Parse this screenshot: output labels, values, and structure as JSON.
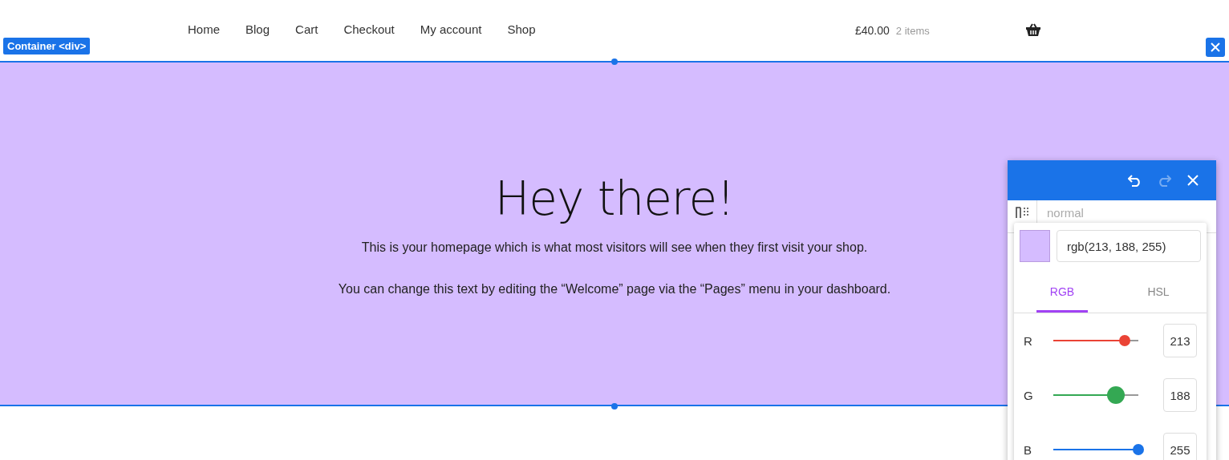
{
  "nav": {
    "links": [
      "Home",
      "Blog",
      "Cart",
      "Checkout",
      "My account",
      "Shop"
    ],
    "cart_total": "£40.00",
    "cart_count": "2 items"
  },
  "element_label": "Container <div>",
  "hero": {
    "title": "Hey there!",
    "paragraphs": [
      "This is your homepage which is what most visitors will see when they first visit your shop.",
      "You can change this text by editing the “Welcome” page via the “Pages” menu in your dashboard."
    ]
  },
  "editor": {
    "undo_enabled": true,
    "redo_enabled": false,
    "select_value": "normal"
  },
  "picker": {
    "value": "rgb(213, 188, 255)",
    "tabs": [
      {
        "label": "RGB",
        "selected": true
      },
      {
        "label": "HSL",
        "selected": false
      }
    ],
    "channels": [
      {
        "label": "R",
        "level": 0.835,
        "value": "213",
        "color": "#ea4335",
        "focused": false
      },
      {
        "label": "G",
        "level": 0.737,
        "value": "188",
        "color": "#34a853",
        "focused": true
      },
      {
        "label": "B",
        "level": 1.0,
        "value": "255",
        "color": "#1a73e8",
        "focused": false
      }
    ]
  }
}
